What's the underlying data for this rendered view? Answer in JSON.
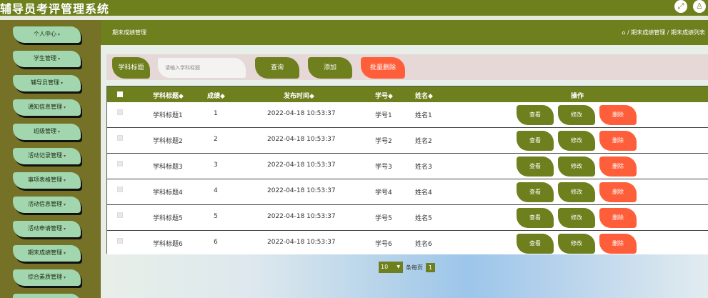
{
  "header": {
    "title": "辅导员考评管理系统",
    "icons": [
      "expand-icon",
      "user-icon"
    ]
  },
  "sidebar": {
    "items": [
      {
        "label": "个人中心"
      },
      {
        "label": "学生管理"
      },
      {
        "label": "辅导员管理"
      },
      {
        "label": "通知信息管理"
      },
      {
        "label": "班级管理"
      },
      {
        "label": "活动记录管理"
      },
      {
        "label": "事项表格管理"
      },
      {
        "label": "活动信息管理"
      },
      {
        "label": "活动申请管理"
      },
      {
        "label": "期末成绩管理"
      },
      {
        "label": "综合素质管理"
      }
    ]
  },
  "page": {
    "title": "期末成绩管理",
    "breadcrumb": "/ 期末成绩管理 / 期末成绩列表"
  },
  "search": {
    "label": "学科标题",
    "placeholder": "请输入学科标题",
    "query_button": "查询",
    "add_button": "添加",
    "batch_delete_button": "批量删除"
  },
  "table": {
    "headers": {
      "subject": "学科标题◆",
      "score": "成绩◆",
      "time": "发布时间◆",
      "student_id": "学号◆",
      "name": "姓名◆",
      "actions": "操作"
    },
    "rows": [
      {
        "subject": "学科标题1",
        "score": "1",
        "time": "2022-04-18 10:53:37",
        "student_id": "学号1",
        "name": "姓名1"
      },
      {
        "subject": "学科标题2",
        "score": "2",
        "time": "2022-04-18 10:53:37",
        "student_id": "学号2",
        "name": "姓名2"
      },
      {
        "subject": "学科标题3",
        "score": "3",
        "time": "2022-04-18 10:53:37",
        "student_id": "学号3",
        "name": "姓名3"
      },
      {
        "subject": "学科标题4",
        "score": "4",
        "time": "2022-04-18 10:53:37",
        "student_id": "学号4",
        "name": "姓名4"
      },
      {
        "subject": "学科标题5",
        "score": "5",
        "time": "2022-04-18 10:53:37",
        "student_id": "学号5",
        "name": "姓名5"
      },
      {
        "subject": "学科标题6",
        "score": "6",
        "time": "2022-04-18 10:53:37",
        "student_id": "学号6",
        "name": "姓名6"
      }
    ],
    "actions": {
      "view": "查看",
      "edit": "修改",
      "delete": "删除"
    }
  },
  "pagination": {
    "page_size": "10",
    "per_page_label": "条每页",
    "current_page": "1"
  },
  "colors": {
    "primary": "#6e7f1d",
    "sidebar_bg": "#757126",
    "menu_item": "#a2d6ae",
    "danger": "#ff5e3a"
  }
}
